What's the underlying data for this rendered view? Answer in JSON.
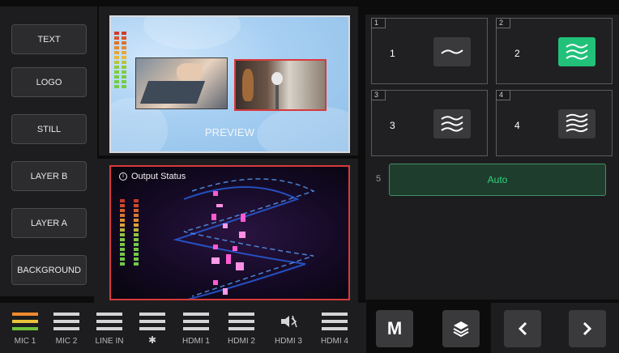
{
  "layers": [
    {
      "label": "TEXT"
    },
    {
      "label": "LOGO"
    },
    {
      "label": "STILL"
    },
    {
      "label": "LAYER B"
    },
    {
      "label": "LAYER A"
    },
    {
      "label": "BACKGROUND"
    }
  ],
  "preview": {
    "label": "PREVIEW"
  },
  "output": {
    "title": "Output Status",
    "info_icon": "info-icon"
  },
  "scenes": [
    {
      "tag": "1",
      "number": "1",
      "icon": "wave-1-icon",
      "active": false
    },
    {
      "tag": "2",
      "number": "2",
      "icon": "wave-3-icon",
      "active": true
    },
    {
      "tag": "3",
      "number": "3",
      "icon": "wave-3-icon",
      "active": false
    },
    {
      "tag": "4",
      "number": "4",
      "icon": "wave-4-icon",
      "active": false
    }
  ],
  "auto": {
    "row_number": "5",
    "label": "Auto"
  },
  "audio_channels": [
    {
      "label": "MIC 1",
      "icon": "level-bars-icon"
    },
    {
      "label": "MIC 2",
      "icon": "level-bars-icon"
    },
    {
      "label": "LINE IN",
      "icon": "level-bars-icon"
    },
    {
      "label": "",
      "icon": "bluetooth-icon"
    },
    {
      "label": "HDMI 1",
      "icon": "level-bars-icon"
    },
    {
      "label": "HDMI 2",
      "icon": "level-bars-icon"
    },
    {
      "label": "HDMI 3",
      "icon": "mute-icon"
    },
    {
      "label": "HDMI 4",
      "icon": "level-bars-icon"
    }
  ],
  "bottom_buttons": {
    "m_label": "M",
    "layers_icon": "layers-icon",
    "prev_icon": "chevron-left-icon",
    "next_icon": "chevron-right-icon"
  },
  "colors": {
    "accent_green": "#21c17a",
    "auto_text": "#2ed47f",
    "output_border": "#d8393c",
    "active_mic": "#f08a2c"
  }
}
